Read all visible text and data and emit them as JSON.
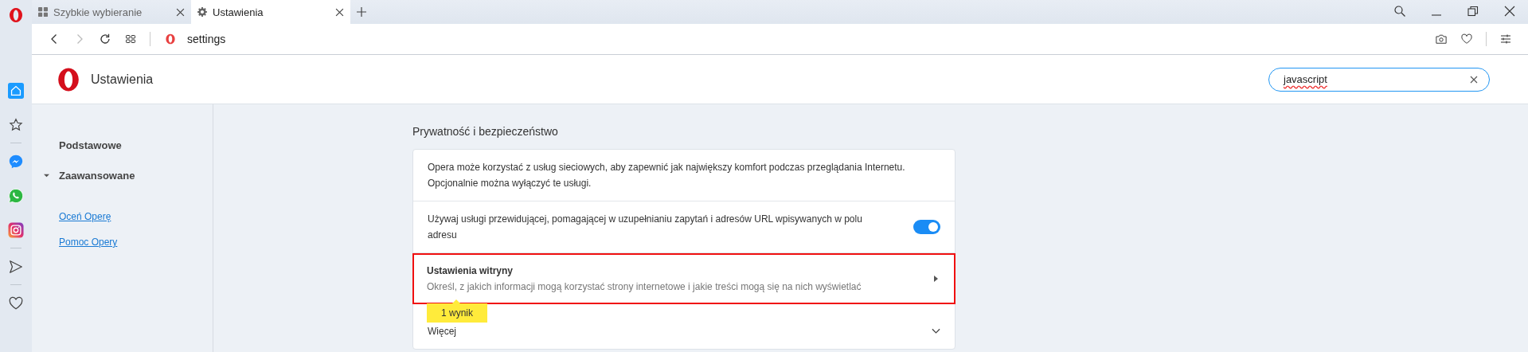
{
  "browser": {
    "tabs": [
      {
        "label": "Szybkie wybieranie",
        "kind": "speed-dial",
        "selected": false
      },
      {
        "label": "Ustawienia",
        "kind": "settings",
        "selected": true
      }
    ],
    "address": "settings"
  },
  "sidebar": {
    "groups": [
      [
        {
          "kind": "home",
          "selected": true
        },
        {
          "kind": "bookmarks",
          "selected": false
        }
      ],
      [
        {
          "kind": "messenger",
          "selected": false
        },
        {
          "kind": "whatsapp",
          "selected": false
        },
        {
          "kind": "instagram",
          "selected": false
        }
      ],
      [
        {
          "kind": "send",
          "selected": false
        }
      ],
      [
        {
          "kind": "heart",
          "selected": false
        }
      ]
    ]
  },
  "settings": {
    "title": "Ustawienia",
    "search": {
      "value": "javascript"
    },
    "nav": [
      {
        "label": "Podstawowe",
        "kind": "section"
      },
      {
        "label": "Zaawansowane",
        "kind": "group",
        "expanded": true
      }
    ],
    "links": [
      "Oceń Operę",
      "Pomoc Opery"
    ],
    "section": {
      "title": "Prywatność i bezpieczeństwo",
      "rows": [
        {
          "kind": "text",
          "text": "Opera może korzystać z usług sieciowych, aby zapewnić jak największy komfort podczas przeglądania Internetu. Opcjonalnie można wyłączyć te usługi."
        },
        {
          "kind": "toggle",
          "text": "Używaj usługi przewidującej, pomagającej w uzupełnianiu zapytań i adresów URL wpisywanych w polu adresu",
          "on": true
        },
        {
          "kind": "link",
          "title": "Ustawienia witryny",
          "description": "Określ, z jakich informacji mogą korzystać strony internetowe i jakie treści mogą się na nich wyświetlać",
          "highlighted": true
        },
        {
          "kind": "expand",
          "label": "Więcej",
          "expanded": false
        }
      ],
      "match_badge": "1 wynik"
    }
  }
}
